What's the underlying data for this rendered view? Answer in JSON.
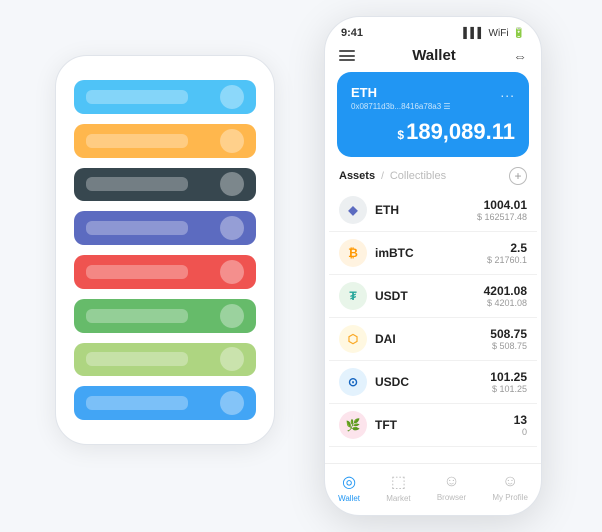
{
  "bgPhone": {
    "cards": [
      {
        "color": "#4fc3f7",
        "id": "card-blue"
      },
      {
        "color": "#ffb74d",
        "id": "card-orange"
      },
      {
        "color": "#37474f",
        "id": "card-dark"
      },
      {
        "color": "#5c6bc0",
        "id": "card-indigo"
      },
      {
        "color": "#ef5350",
        "id": "card-red"
      },
      {
        "color": "#66bb6a",
        "id": "card-green"
      },
      {
        "color": "#aed581",
        "id": "card-light-green"
      },
      {
        "color": "#42a5f5",
        "id": "card-blue2"
      }
    ]
  },
  "mainPhone": {
    "statusBar": {
      "time": "9:41",
      "signal": "▌▌▌",
      "wifi": "◀",
      "battery": "▮"
    },
    "nav": {
      "title": "Wallet",
      "expandIcon": "⇔"
    },
    "ethCard": {
      "label": "ETH",
      "moreIcon": "...",
      "address": "0x08711d3b...8416a78a3 ☰",
      "dollarSign": "$",
      "amount": "189,089.11"
    },
    "assetsHeader": {
      "tabActive": "Assets",
      "separator": "/",
      "tabInactive": "Collectibles",
      "addIcon": "+"
    },
    "assets": [
      {
        "name": "ETH",
        "amount": "1004.01",
        "usd": "$ 162517.48",
        "iconColor": "#eceff1",
        "iconText": "♦",
        "iconEmoji": "⬡"
      },
      {
        "name": "imBTC",
        "amount": "2.5",
        "usd": "$ 21760.1",
        "iconColor": "#fff3e0",
        "iconText": "₿"
      },
      {
        "name": "USDT",
        "amount": "4201.08",
        "usd": "$ 4201.08",
        "iconColor": "#e8f5e9",
        "iconText": "₮"
      },
      {
        "name": "DAI",
        "amount": "508.75",
        "usd": "$ 508.75",
        "iconColor": "#fff8e1",
        "iconText": "◈"
      },
      {
        "name": "USDC",
        "amount": "101.25",
        "usd": "$ 101.25",
        "iconColor": "#e3f2fd",
        "iconText": "⊙"
      },
      {
        "name": "TFT",
        "amount": "13",
        "usd": "0",
        "iconColor": "#fce4ec",
        "iconText": "🌿"
      }
    ],
    "bottomNav": [
      {
        "id": "wallet",
        "label": "Wallet",
        "icon": "◎",
        "active": true
      },
      {
        "id": "market",
        "label": "Market",
        "icon": "📈",
        "active": false
      },
      {
        "id": "browser",
        "label": "Browser",
        "icon": "👤",
        "active": false
      },
      {
        "id": "profile",
        "label": "My Profile",
        "icon": "👤",
        "active": false
      }
    ]
  }
}
